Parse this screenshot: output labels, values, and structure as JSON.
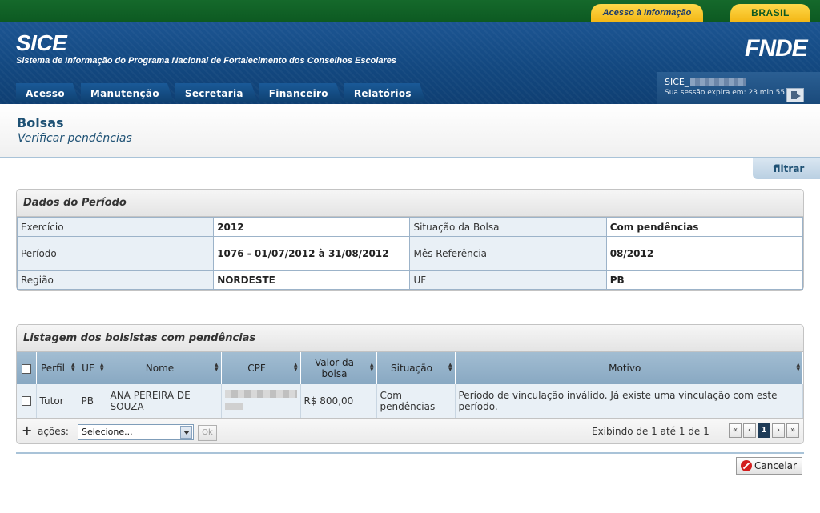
{
  "gov_bar": {
    "acesso_label": "Acesso à Informação",
    "brasil_label": "BRASIL"
  },
  "header": {
    "title": "SICE",
    "subtitle": "Sistema de Informação do Programa Nacional de Fortalecimento dos Conselhos Escolares",
    "logo": "FNDE"
  },
  "nav": {
    "items": [
      "Acesso",
      "Manutenção",
      "Secretaria",
      "Financeiro",
      "Relatórios"
    ]
  },
  "session": {
    "user": "SICE_",
    "expires": "Sua sessão expira em: 23 min 55"
  },
  "page": {
    "title": "Bolsas",
    "subtitle": "Verificar pendências",
    "filter_label": "filtrar"
  },
  "period": {
    "header": "Dados do Período",
    "rows": [
      {
        "label1": "Exercício",
        "value1": "2012",
        "label2": "Situação da Bolsa",
        "value2": "Com pendências"
      },
      {
        "label1": "Período",
        "value1": "1076 - 01/07/2012 à 31/08/2012",
        "label2": "Mês Referência",
        "value2": "08/2012"
      },
      {
        "label1": "Região",
        "value1": "NORDESTE",
        "label2": "UF",
        "value2": "PB"
      }
    ]
  },
  "listing": {
    "header": "Listagem dos bolsistas com pendências",
    "columns": [
      "Perfil",
      "UF",
      "Nome",
      "CPF",
      "Valor da bolsa",
      "Situação",
      "Motivo"
    ],
    "rows": [
      {
        "perfil": "Tutor",
        "uf": "PB",
        "nome": "ANA PEREIRA DE SOUZA",
        "valor": "R$ 800,00",
        "situacao": "Com pendências",
        "motivo": "Período de vinculação inválido. Já existe uma vinculação com este período."
      }
    ],
    "footer": {
      "plus": "+",
      "acoes_label": "ações:",
      "select_value": "Selecione...",
      "ok_label": "Ok",
      "pager_text": "Exibindo de 1 até 1 de 1",
      "pager": {
        "first": "«",
        "prev": "‹",
        "current": "1",
        "next": "›",
        "last": "»"
      }
    }
  },
  "cancel_label": "Cancelar"
}
